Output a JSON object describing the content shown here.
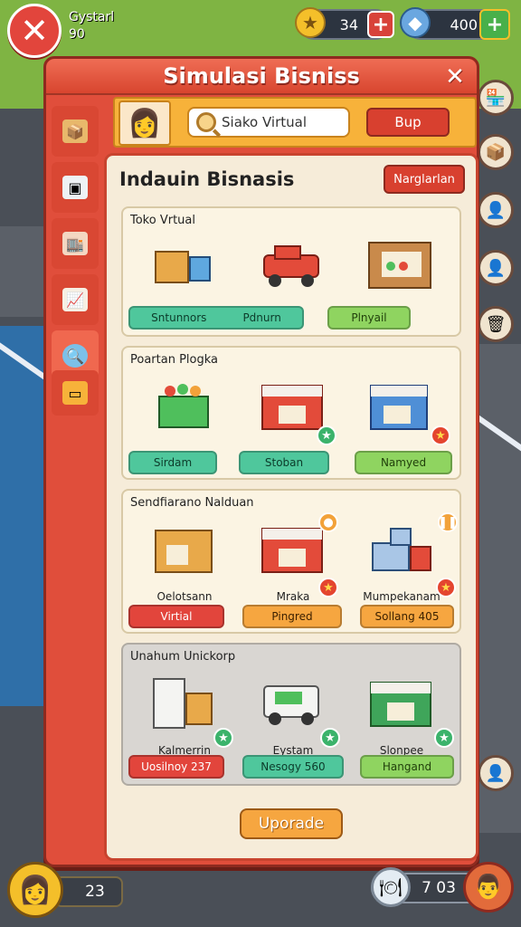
{
  "hud": {
    "player_name": "Gystarl",
    "player_level": "90",
    "coins": "34",
    "gems": "400",
    "bottom_left_value": "23",
    "bottom_right_value": "7 03"
  },
  "modal": {
    "title": "Simulasi Bisniss",
    "search_placeholder": "Siako Virtual",
    "search_button": "Bup",
    "content_title": "Indauin Bisnasis",
    "content_action": "Narglarlan",
    "upgrade_label": "Uporade"
  },
  "sections": [
    {
      "title": "Toko Vrtual",
      "pills": [
        "Sntunnors",
        "Pdnurn",
        "Plnyail"
      ]
    },
    {
      "title": "Poartan Plogka",
      "pills": [
        "Sirdam",
        "Stoban",
        "Namyed"
      ]
    },
    {
      "title": "Sendfiarano Nalduan",
      "captions": [
        "Oelotsann",
        "Mraka",
        "Mumpekanam"
      ],
      "pills": [
        "Virtial",
        "Pingred",
        "Sollang 405"
      ]
    },
    {
      "title": "Unahum Unickorp",
      "captions": [
        "Kalmerrin",
        "Eystam",
        "Slonpee"
      ],
      "pills": [
        "Uosilnoy 237",
        "Nesogy 560",
        "Hangand"
      ]
    }
  ],
  "colors": {
    "modal_red": "#e04e3b",
    "header_orange": "#f7b23a",
    "panel_cream": "#f6ecd9",
    "pill_teal": "#4fc79c",
    "pill_lime": "#8fd460",
    "pill_red": "#e2453c",
    "pill_orange": "#f6a640"
  }
}
